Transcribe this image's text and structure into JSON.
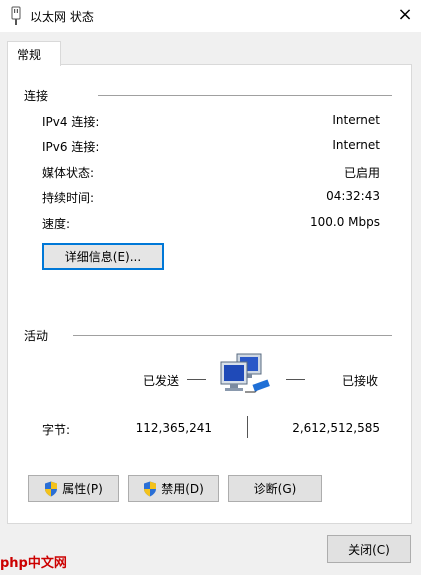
{
  "window": {
    "title": "以太网 状态",
    "close_icon": "×"
  },
  "tabs": [
    {
      "label": "常规"
    }
  ],
  "connection": {
    "section_label": "连接",
    "rows": [
      {
        "label": "IPv4 连接:",
        "value": "Internet"
      },
      {
        "label": "IPv6 连接:",
        "value": "Internet"
      },
      {
        "label": "媒体状态:",
        "value": "已启用"
      },
      {
        "label": "持续时间:",
        "value": "04:32:43"
      },
      {
        "label": "速度:",
        "value": "100.0 Mbps"
      }
    ],
    "details_button": "详细信息(E)..."
  },
  "activity": {
    "section_label": "活动",
    "sent_label": "已发送",
    "received_label": "已接收",
    "bytes_label": "字节:",
    "bytes_sent": "112,365,241",
    "bytes_received": "2,612,512,585"
  },
  "buttons": {
    "properties": "属性(P)",
    "disable": "禁用(D)",
    "diagnose": "诊断(G)",
    "close": "关闭(C)"
  },
  "watermark": "php中文网",
  "colors": {
    "focus_border": "#0078d7",
    "shield_blue": "#2a6fd6",
    "shield_yellow": "#f4c21b"
  }
}
